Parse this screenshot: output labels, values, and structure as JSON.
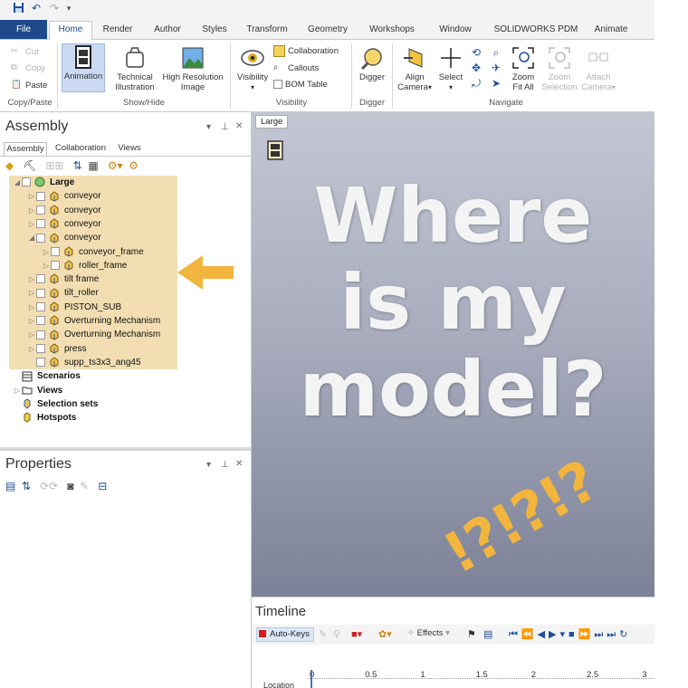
{
  "ribbon_tabs": [
    "File",
    "Home",
    "Render",
    "Author",
    "Styles",
    "Transform",
    "Geometry",
    "Workshops",
    "Window",
    "SOLIDWORKS PDM",
    "Animate"
  ],
  "active_tab": "Home",
  "clipboard": {
    "cut": "Cut",
    "copy": "Copy",
    "paste": "Paste",
    "group": "Copy/Paste"
  },
  "showhide": {
    "animation": "Animation",
    "technical": [
      "Technical",
      "Illustration"
    ],
    "highres": [
      "High Resolution",
      "Image"
    ],
    "group": "Show/Hide"
  },
  "visibility": {
    "visibility": "Visibility",
    "collaboration": "Collaboration",
    "callouts": "Callouts",
    "bom": "BOM Table",
    "group": "Visibility"
  },
  "digger": {
    "label": "Digger",
    "group": "Digger"
  },
  "navigate": {
    "align": [
      "Align",
      "Camera"
    ],
    "select": "Select",
    "zoomfit": [
      "Zoom",
      "Fit All"
    ],
    "zoomsel": [
      "Zoom",
      "Selection"
    ],
    "attach": [
      "Attach",
      "Camera"
    ],
    "group": "Navigate"
  },
  "assembly_pane": {
    "title": "Assembly",
    "subtabs": [
      "Assembly",
      "Collaboration",
      "Views"
    ],
    "tree": [
      {
        "label": "Large",
        "bold": true,
        "indent": 0,
        "expander": "◢",
        "cb": true,
        "icon": "globe"
      },
      {
        "label": "conveyor",
        "indent": 1,
        "expander": "▷",
        "cb": true,
        "icon": "part"
      },
      {
        "label": "conveyor",
        "indent": 1,
        "expander": "▷",
        "cb": true,
        "icon": "part"
      },
      {
        "label": "conveyor",
        "indent": 1,
        "expander": "▷",
        "cb": true,
        "icon": "part"
      },
      {
        "label": "conveyor",
        "indent": 1,
        "expander": "◢",
        "cb": true,
        "icon": "part"
      },
      {
        "label": "conveyor_frame",
        "indent": 2,
        "expander": "▷",
        "cb": true,
        "icon": "part"
      },
      {
        "label": "roller_frame",
        "indent": 2,
        "expander": "▷",
        "cb": true,
        "icon": "part"
      },
      {
        "label": "tilt frame",
        "indent": 1,
        "expander": "▷",
        "cb": true,
        "icon": "part"
      },
      {
        "label": "tilt_roller",
        "indent": 1,
        "expander": "▷",
        "cb": true,
        "icon": "part"
      },
      {
        "label": "PISTON_SUB",
        "indent": 1,
        "expander": "▷",
        "cb": true,
        "icon": "part"
      },
      {
        "label": "Overturning Mechanism",
        "indent": 1,
        "expander": "▷",
        "cb": true,
        "icon": "part"
      },
      {
        "label": "Overturning Mechanism",
        "indent": 1,
        "expander": "▷",
        "cb": true,
        "icon": "part"
      },
      {
        "label": "press",
        "indent": 1,
        "expander": "▷",
        "cb": true,
        "icon": "part"
      },
      {
        "label": "supp_ts3x3_ang45",
        "indent": 1,
        "expander": "",
        "cb": true,
        "icon": "part"
      },
      {
        "label": "Scenarios",
        "bold": true,
        "indent": 0,
        "expander": "",
        "cb": false,
        "icon": "scenario"
      },
      {
        "label": "Views",
        "bold": true,
        "indent": 0,
        "expander": "▷",
        "cb": false,
        "icon": "folder"
      },
      {
        "label": "Selection sets",
        "bold": true,
        "indent": 0,
        "expander": "",
        "cb": false,
        "icon": "selset"
      },
      {
        "label": "Hotspots",
        "bold": true,
        "indent": 0,
        "expander": "",
        "cb": false,
        "icon": "hotspot"
      }
    ]
  },
  "properties_pane": {
    "title": "Properties"
  },
  "viewport": {
    "tab": "Large",
    "overlay_lines": [
      "Where",
      "is my",
      "model?"
    ],
    "exclaim": "!?!?!?"
  },
  "timeline": {
    "title": "Timeline",
    "autokeys": "Auto-Keys",
    "effects": "Effects",
    "ticks": [
      "0",
      "0.5",
      "1",
      "1.5",
      "2",
      "2.5",
      "3"
    ],
    "row_label": "Location"
  },
  "colors": {
    "file_tab": "#1e4a8c",
    "highlight": "#f2deb2",
    "arrow": "#f2b53d",
    "overlay_text": "#f4f4f4"
  }
}
